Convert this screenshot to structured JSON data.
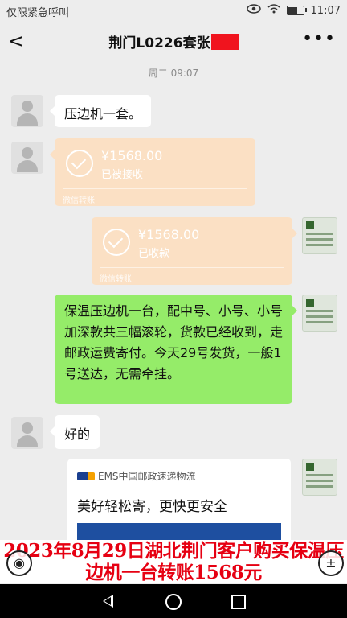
{
  "status_bar": {
    "carrier": "仅限紧急呼叫",
    "time": "11:07",
    "battery_level": 0.55
  },
  "nav": {
    "title": "荆门L0226套张",
    "back_icon": "chevron-left-icon",
    "more_icon": "ellipsis-icon",
    "back_glyph": "<",
    "more_glyph": "•••"
  },
  "timestamp": "周二 09:07",
  "messages": [
    {
      "side": "left",
      "type": "text",
      "text": "压边机一套。"
    },
    {
      "side": "left",
      "type": "transfer",
      "amount": "¥1568.00",
      "status": "已被接收",
      "label": "微信转账"
    },
    {
      "side": "right",
      "type": "transfer",
      "amount": "¥1568.00",
      "status": "已收款",
      "label": "微信转账"
    },
    {
      "side": "right",
      "type": "text",
      "text": "保温压边机一台，配中号、小号、小号加深款共三幅滚轮，货款已经收到，走邮政运费寄付。今天29号发货，一般1号送达，无需牵挂。"
    },
    {
      "side": "left",
      "type": "text",
      "text": "好的"
    },
    {
      "side": "right",
      "type": "card",
      "header": "EMS中国邮政速递物流",
      "title": "美好轻松寄，更快更安全"
    }
  ],
  "caption": "2023年8月29日湖北荆门客户购买保温压边机一台转账1568元",
  "float_left_glyph": "◉",
  "float_right_glyph": "±",
  "colors": {
    "green_bubble": "#95ec69",
    "transfer_bg": "#fbe0c4",
    "caption_red": "#e60012"
  }
}
